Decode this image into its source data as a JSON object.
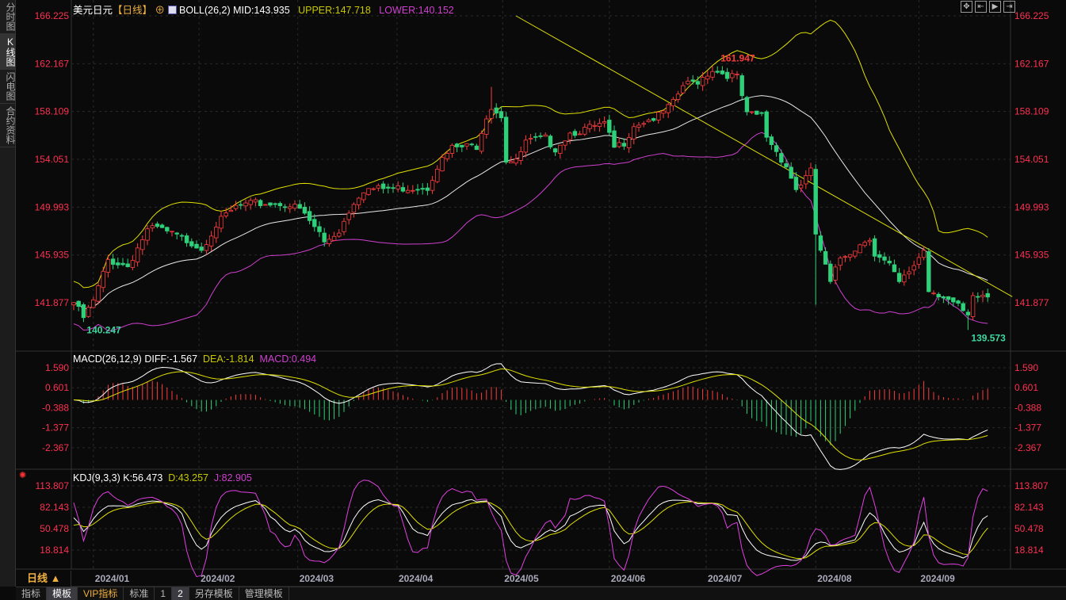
{
  "sidebar": {
    "tabs": [
      "分时图",
      "K线图",
      "闪电图",
      "合约资料"
    ],
    "active": 1
  },
  "header": {
    "symbol": "美元日元",
    "period_tag": "【日线】",
    "indicator": "BOLL(26,2)",
    "mid": "MID:143.935",
    "upper": "UPPER:147.718",
    "lower": "LOWER:140.152"
  },
  "macd_header": {
    "name": "MACD(26,12,9)",
    "diff": "DIFF:-1.567",
    "dea": "DEA:-1.814",
    "macd": "MACD:0.494"
  },
  "kdj_header": {
    "name": "KDJ(9,3,3)",
    "k": "K:56.473",
    "d": "D:43.257",
    "j": "J:82.905"
  },
  "period_label": "日线 ▲",
  "bottom_tabs": [
    "指标",
    "模板",
    "VIP指标",
    "标准",
    "1",
    "2",
    "另存模板",
    "管理模板"
  ],
  "colors": {
    "up": "#ff3c3c",
    "down": "#2fd07a",
    "mid": "#e8e8e8",
    "upper": "#e0e000",
    "lower": "#d040d0",
    "axis": "#ff3050"
  },
  "chart_data": {
    "type": "candlestick",
    "title": "美元日元 日线",
    "candle_count": 187,
    "close_keypoints": [
      [
        0,
        141.9
      ],
      [
        2,
        140.6
      ],
      [
        4,
        142
      ],
      [
        7,
        145.5
      ],
      [
        11,
        145
      ],
      [
        14,
        147.3
      ],
      [
        15,
        148.0
      ],
      [
        17,
        148.2
      ],
      [
        24,
        147.0
      ],
      [
        26,
        146.5
      ],
      [
        29,
        148.5
      ],
      [
        33,
        150.0
      ],
      [
        37,
        150.3
      ],
      [
        43,
        150.3
      ],
      [
        46,
        149.8
      ],
      [
        50,
        147.8
      ],
      [
        51,
        147
      ],
      [
        54,
        148
      ],
      [
        57,
        150.5
      ],
      [
        59,
        151.5
      ],
      [
        66,
        151.6
      ],
      [
        72,
        151.7
      ],
      [
        74,
        153.5
      ],
      [
        77,
        155.0
      ],
      [
        82,
        155.2
      ],
      [
        84,
        157.8
      ],
      [
        85,
        158.5
      ],
      [
        87,
        157.8
      ],
      [
        88,
        154
      ],
      [
        90,
        153.8
      ],
      [
        92,
        155.5
      ],
      [
        96,
        155.8
      ],
      [
        98,
        155.0
      ],
      [
        101,
        156.3
      ],
      [
        106,
        156.8
      ],
      [
        108,
        157
      ],
      [
        110,
        155.0
      ],
      [
        112,
        155.5
      ],
      [
        114,
        157
      ],
      [
        119,
        157.7
      ],
      [
        122,
        158.8
      ],
      [
        124,
        160.3
      ],
      [
        127,
        160.7
      ],
      [
        130,
        161.7
      ],
      [
        131,
        161.5
      ],
      [
        135,
        161.0
      ],
      [
        137,
        157.8
      ],
      [
        140,
        157.8
      ],
      [
        141,
        156.0
      ],
      [
        145,
        153.5
      ],
      [
        147,
        151.5
      ],
      [
        150,
        153
      ],
      [
        151,
        147.7
      ],
      [
        154,
        143.5
      ],
      [
        156,
        145.7
      ],
      [
        159,
        146.5
      ],
      [
        162,
        147.5
      ],
      [
        163,
        146
      ],
      [
        166,
        145.0
      ],
      [
        168,
        143.5
      ],
      [
        170,
        144.5
      ],
      [
        173,
        146.4
      ],
      [
        174,
        143
      ],
      [
        177,
        142.5
      ],
      [
        180,
        141.5
      ],
      [
        182,
        140.6
      ],
      [
        183,
        142.2
      ],
      [
        185,
        142.5
      ],
      [
        186,
        142.4
      ]
    ],
    "price_axis": {
      "labels": [
        "166.225",
        "162.167",
        "158.109",
        "154.051",
        "149.993",
        "145.935",
        "141.877"
      ],
      "range": [
        139.0,
        166.225
      ]
    },
    "annotations": [
      {
        "text": "161.947",
        "index": 131,
        "price": 161.947,
        "color": "#ff3c3c"
      },
      {
        "text": "140.247",
        "index": 2,
        "price": 140.247,
        "color": "#3cd8a0"
      },
      {
        "text": "139.573",
        "index": 182,
        "price": 139.573,
        "color": "#3cd8a0"
      }
    ],
    "trendline": {
      "from": [
        90,
        166.225
      ],
      "to": [
        191,
        142.4
      ]
    },
    "boll": {
      "period": 26,
      "k": 2
    },
    "macd_axis": {
      "labels": [
        "1.590",
        "0.601",
        "-0.388",
        "-1.377",
        "-2.367"
      ]
    },
    "kdj_axis": {
      "labels": [
        "113.807",
        "82.143",
        "50.478",
        "18.814"
      ]
    },
    "months": [
      {
        "label": "2024/01",
        "index": 4
      },
      {
        "label": "2024/02",
        "index": 25.5
      },
      {
        "label": "2024/03",
        "index": 45.6
      },
      {
        "label": "2024/04",
        "index": 65.8
      },
      {
        "label": "2024/05",
        "index": 87.3
      },
      {
        "label": "2024/06",
        "index": 109
      },
      {
        "label": "2024/07",
        "index": 128.7
      },
      {
        "label": "2024/08",
        "index": 151
      },
      {
        "label": "2024/09",
        "index": 172
      }
    ]
  }
}
